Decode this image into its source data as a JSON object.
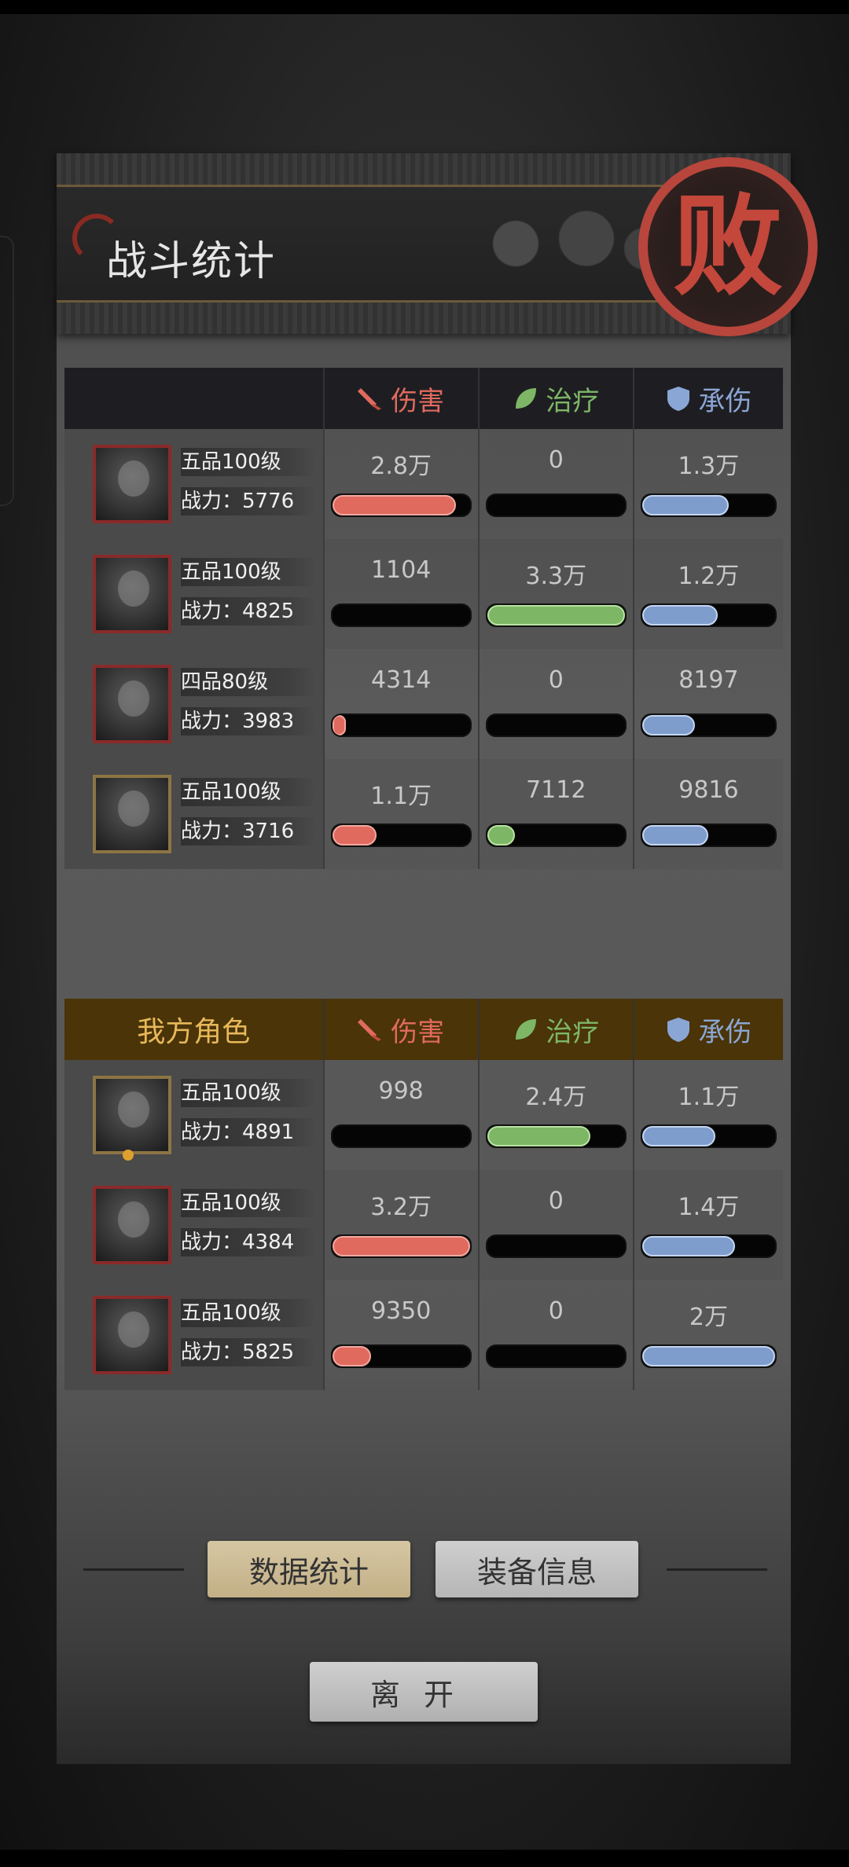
{
  "title": "战斗统计",
  "seal": "败",
  "columns": {
    "damage": "伤害",
    "heal": "治疗",
    "tank": "承伤"
  },
  "enemy_rows": [
    {
      "grade": "五品100级",
      "power": "战力：5776",
      "damage": "2.8万",
      "heal": "0",
      "tank": "1.3万",
      "damage_frac": 0.9,
      "heal_frac": 0,
      "tank_frac": 0.65
    },
    {
      "grade": "五品100级",
      "power": "战力：4825",
      "damage": "1104",
      "heal": "3.3万",
      "tank": "1.2万",
      "damage_frac": 0,
      "heal_frac": 1.0,
      "tank_frac": 0.57
    },
    {
      "grade": "四品80级",
      "power": "战力：3983",
      "damage": "4314",
      "heal": "0",
      "tank": "8197",
      "damage_frac": 0.1,
      "heal_frac": 0,
      "tank_frac": 0.4
    },
    {
      "grade": "五品100级",
      "power": "战力：3716",
      "damage": "1.1万",
      "heal": "7112",
      "tank": "9816",
      "damage_frac": 0.32,
      "heal_frac": 0.2,
      "tank_frac": 0.5
    }
  ],
  "my_header": "我方角色",
  "my_rows": [
    {
      "grade": "五品100级",
      "power": "战力：4891",
      "damage": "998",
      "heal": "2.4万",
      "tank": "1.1万",
      "damage_frac": 0,
      "heal_frac": 0.75,
      "tank_frac": 0.55
    },
    {
      "grade": "五品100级",
      "power": "战力：4384",
      "damage": "3.2万",
      "heal": "0",
      "tank": "1.4万",
      "damage_frac": 1.0,
      "heal_frac": 0,
      "tank_frac": 0.7
    },
    {
      "grade": "五品100级",
      "power": "战力：5825",
      "damage": "9350",
      "heal": "0",
      "tank": "2万",
      "damage_frac": 0.28,
      "heal_frac": 0,
      "tank_frac": 1.0
    }
  ],
  "buttons": {
    "stats": "数据统计",
    "equip": "装备信息",
    "leave": "离开"
  },
  "colors": {
    "damage": "#e06a5e",
    "heal": "#7db766",
    "tank": "#8aa6d4"
  }
}
